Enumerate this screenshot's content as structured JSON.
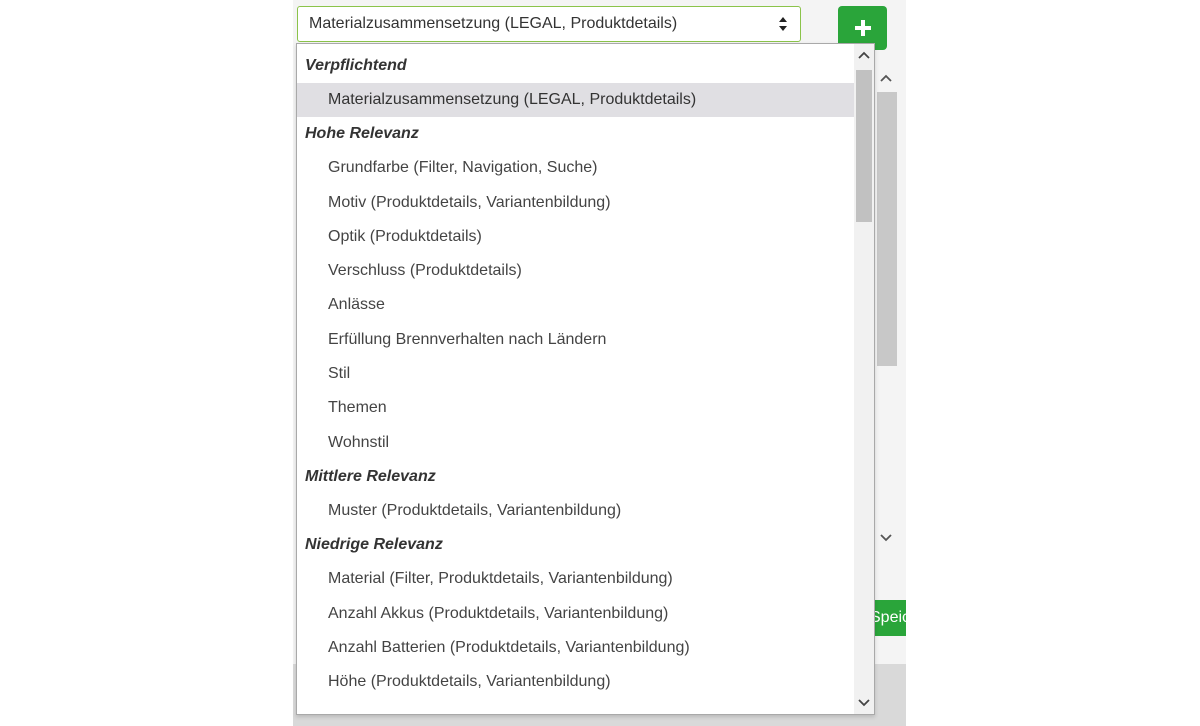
{
  "select": {
    "value": "Materialzusammensetzung (LEGAL, Produktdetails)"
  },
  "save_button": {
    "label": "Speichern"
  },
  "dropdown": {
    "groups": [
      {
        "label": "Verpflichtend",
        "options": [
          "Materialzusammensetzung (LEGAL, Produktdetails)"
        ]
      },
      {
        "label": "Hohe Relevanz",
        "options": [
          "Grundfarbe (Filter, Navigation, Suche)",
          "Motiv (Produktdetails, Variantenbildung)",
          "Optik (Produktdetails)",
          "Verschluss (Produktdetails)",
          "Anlässe",
          "Erfüllung Brennverhalten nach Ländern",
          "Stil",
          "Themen",
          "Wohnstil"
        ]
      },
      {
        "label": "Mittlere Relevanz",
        "options": [
          "Muster (Produktdetails, Variantenbildung)"
        ]
      },
      {
        "label": "Niedrige Relevanz",
        "options": [
          "Material (Filter, Produktdetails, Variantenbildung)",
          "Anzahl Akkus (Produktdetails, Variantenbildung)",
          "Anzahl Batterien (Produktdetails, Variantenbildung)",
          "Höhe (Produktdetails, Variantenbildung)"
        ]
      }
    ],
    "selected_value": "Materialzusammensetzung (LEGAL, Produktdetails)"
  },
  "icons": {
    "add": "plus-icon",
    "select_arrows": "sort-arrows-icon",
    "scroll_up": "chevron-up-icon",
    "scroll_down": "chevron-down-icon"
  },
  "colors": {
    "accent_green": "#2aa53a",
    "select_border": "#8bc34a",
    "selected_option_bg": "#e0dfe3"
  }
}
